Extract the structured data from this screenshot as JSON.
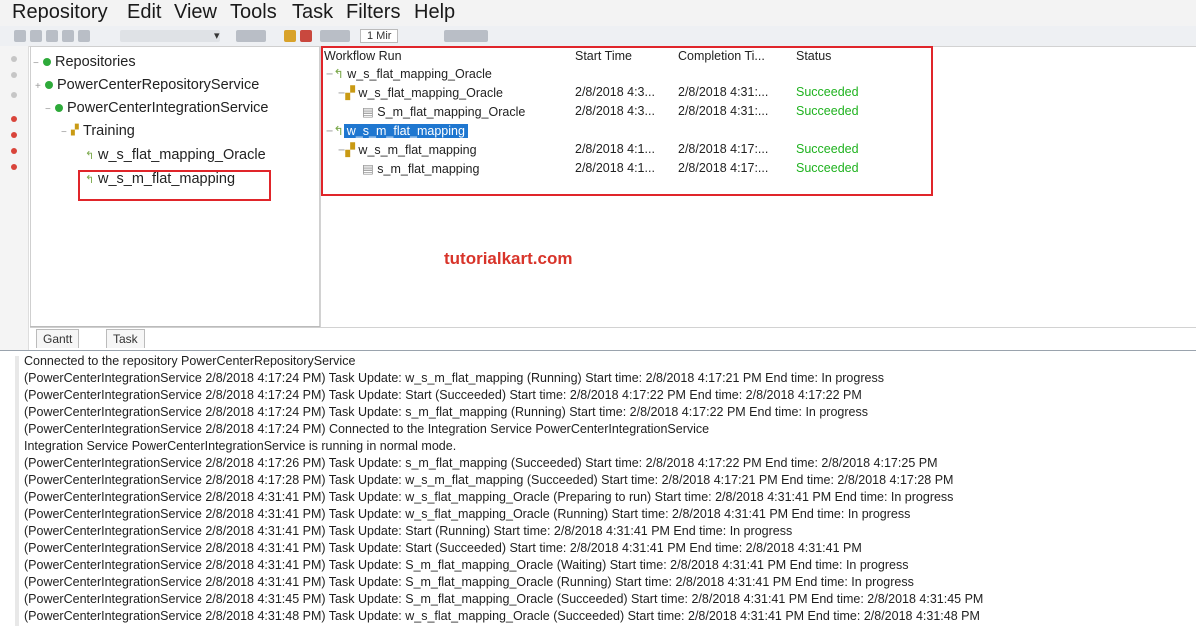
{
  "menu": [
    "Repository",
    "Edit",
    "View",
    "Tools",
    "Task",
    "Filters",
    "Help"
  ],
  "toolbar": {
    "time_value": "1 Mir"
  },
  "navigator": {
    "root": "Repositories",
    "repo_service": "PowerCenterRepositoryService",
    "integration_service": "PowerCenterIntegrationService",
    "folder": "Training",
    "workflows": [
      "w_s_flat_mapping_Oracle",
      "w_s_m_flat_mapping"
    ]
  },
  "nav_tabs": [
    "Gantt",
    "Task"
  ],
  "grid": {
    "columns": [
      "Workflow Run",
      "Start Time",
      "Completion Ti...",
      "Status"
    ],
    "rows": [
      {
        "name": "w_s_flat_mapping_Oracle",
        "start": "",
        "completion": "",
        "status": ""
      },
      {
        "name": "w_s_flat_mapping_Oracle",
        "start": "2/8/2018 4:3...",
        "completion": "2/8/2018 4:31:...",
        "status": "Succeeded"
      },
      {
        "name": "S_m_flat_mapping_Oracle",
        "start": "2/8/2018 4:3...",
        "completion": "2/8/2018 4:31:...",
        "status": "Succeeded"
      },
      {
        "name": "w_s_m_flat_mapping",
        "start": "",
        "completion": "",
        "status": ""
      },
      {
        "name": "w_s_m_flat_mapping",
        "start": "2/8/2018 4:1...",
        "completion": "2/8/2018 4:17:...",
        "status": "Succeeded"
      },
      {
        "name": "s_m_flat_mapping",
        "start": "2/8/2018 4:1...",
        "completion": "2/8/2018 4:17:...",
        "status": "Succeeded"
      }
    ]
  },
  "watermark": "tutorialkart.com",
  "log": [
    "Connected to the repository PowerCenterRepositoryService",
    "(PowerCenterIntegrationService 2/8/2018 4:17:24 PM) Task Update: w_s_m_flat_mapping (Running)  Start time: 2/8/2018 4:17:21 PM End time: In progress",
    "(PowerCenterIntegrationService 2/8/2018 4:17:24 PM) Task Update: Start (Succeeded)  Start time: 2/8/2018 4:17:22 PM End time: 2/8/2018 4:17:22 PM",
    "(PowerCenterIntegrationService 2/8/2018 4:17:24 PM) Task Update: s_m_flat_mapping (Running)  Start time: 2/8/2018 4:17:22 PM End time: In progress",
    "(PowerCenterIntegrationService 2/8/2018 4:17:24 PM) Connected to the Integration Service PowerCenterIntegrationService",
    "Integration Service PowerCenterIntegrationService is running in normal mode.",
    "(PowerCenterIntegrationService 2/8/2018 4:17:26 PM) Task Update: s_m_flat_mapping (Succeeded)  Start time: 2/8/2018 4:17:22 PM End time: 2/8/2018 4:17:25 PM",
    "(PowerCenterIntegrationService 2/8/2018 4:17:28 PM) Task Update: w_s_m_flat_mapping (Succeeded)  Start time: 2/8/2018 4:17:21 PM End time: 2/8/2018 4:17:28 PM",
    "(PowerCenterIntegrationService 2/8/2018 4:31:41 PM) Task Update: w_s_flat_mapping_Oracle (Preparing to run)  Start time: 2/8/2018 4:31:41 PM End time: In progress",
    "(PowerCenterIntegrationService 2/8/2018 4:31:41 PM) Task Update: w_s_flat_mapping_Oracle (Running)  Start time: 2/8/2018 4:31:41 PM End time: In progress",
    "(PowerCenterIntegrationService 2/8/2018 4:31:41 PM) Task Update: Start (Running)  Start time: 2/8/2018 4:31:41 PM End time: In progress",
    "(PowerCenterIntegrationService 2/8/2018 4:31:41 PM) Task Update: Start (Succeeded)  Start time: 2/8/2018 4:31:41 PM End time: 2/8/2018 4:31:41 PM",
    "(PowerCenterIntegrationService 2/8/2018 4:31:41 PM) Task Update: S_m_flat_mapping_Oracle (Waiting)  Start time: 2/8/2018 4:31:41 PM End time: In progress",
    "(PowerCenterIntegrationService 2/8/2018 4:31:41 PM) Task Update: S_m_flat_mapping_Oracle (Running)  Start time: 2/8/2018 4:31:41 PM End time: In progress",
    "(PowerCenterIntegrationService 2/8/2018 4:31:45 PM) Task Update: S_m_flat_mapping_Oracle (Succeeded)  Start time: 2/8/2018 4:31:41 PM End time: 2/8/2018 4:31:45 PM",
    "(PowerCenterIntegrationService 2/8/2018 4:31:48 PM) Task Update: w_s_flat_mapping_Oracle (Succeeded)  Start time: 2/8/2018 4:31:41 PM End time: 2/8/2018 4:31:48 PM"
  ]
}
